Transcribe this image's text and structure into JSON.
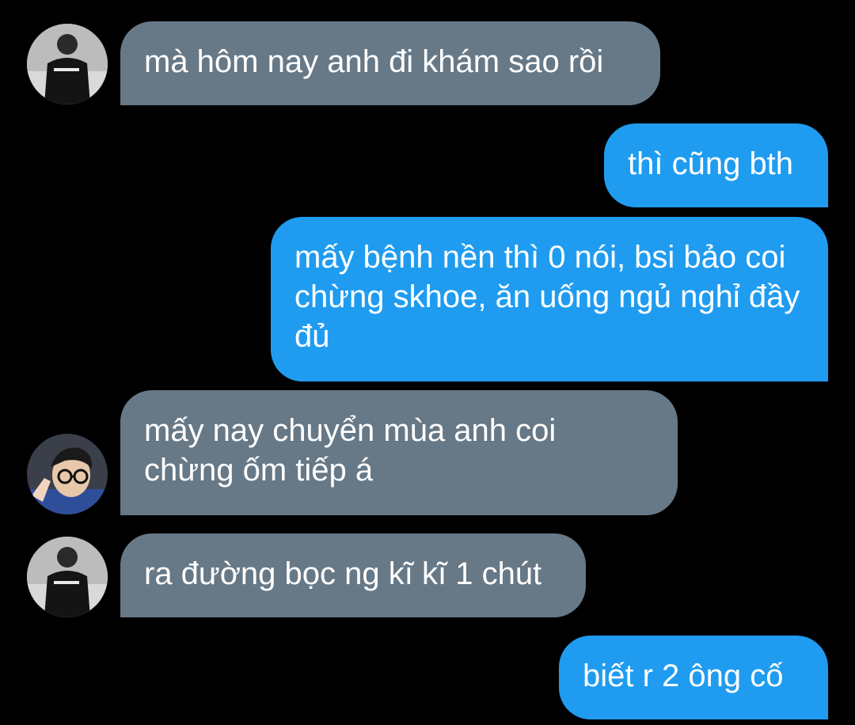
{
  "conversation": {
    "messages": [
      {
        "side": "incoming",
        "text": "mà hôm nay anh đi khám sao rồi",
        "avatar": "person-black-shirt-avatar"
      },
      {
        "side": "outgoing",
        "text": "thì cũng bth"
      },
      {
        "side": "outgoing",
        "text": "mấy bệnh nền thì 0 nói, bsi bảo coi chừng skhoe, ăn uống ngủ nghỉ đầy đủ"
      },
      {
        "side": "incoming",
        "text": "mấy nay chuyển mùa anh coi chừng ốm tiếp á",
        "avatar": "person-glasses-avatar"
      },
      {
        "side": "incoming",
        "text": "ra đường bọc ng kĩ kĩ 1 chút",
        "avatar": "person-black-shirt-avatar"
      },
      {
        "side": "outgoing",
        "text": "biết r 2 ông cố"
      }
    ]
  },
  "colors": {
    "background": "#000000",
    "incoming_bubble": "#677886",
    "outgoing_bubble": "#1f9cf0",
    "text": "#ffffff"
  }
}
